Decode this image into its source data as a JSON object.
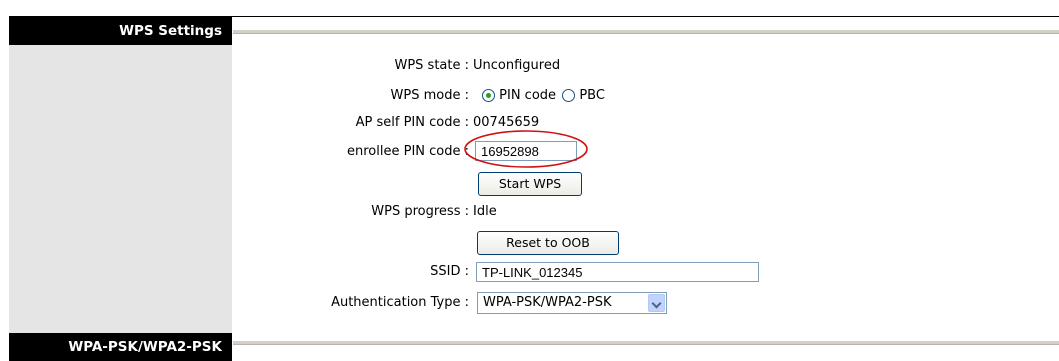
{
  "sections": {
    "wps_settings": "WPS Settings",
    "wpa_psk": "WPA-PSK/WPA2-PSK"
  },
  "fields": {
    "wps_state_label": "WPS state :",
    "wps_state_value": "Unconfigured",
    "wps_mode_label": "WPS mode :",
    "mode_pin_label": "PIN code",
    "mode_pbc_label": "PBC",
    "mode_selected": "PIN code",
    "ap_pin_label": "AP self PIN code :",
    "ap_pin_value": "00745659",
    "enrollee_pin_label": "enrollee PIN code :",
    "enrollee_pin_value": "16952898",
    "start_wps_button": "Start WPS",
    "wps_progress_label": "WPS progress :",
    "wps_progress_value": "Idle",
    "reset_oob_button": "Reset to OOB",
    "ssid_label": "SSID :",
    "ssid_value": "TP-LINK_012345",
    "auth_type_label": "Authentication Type :",
    "auth_type_value": "WPA-PSK/WPA2-PSK"
  },
  "colors": {
    "annotation_circle": "#d01010",
    "radio_dot": "#21a121"
  }
}
